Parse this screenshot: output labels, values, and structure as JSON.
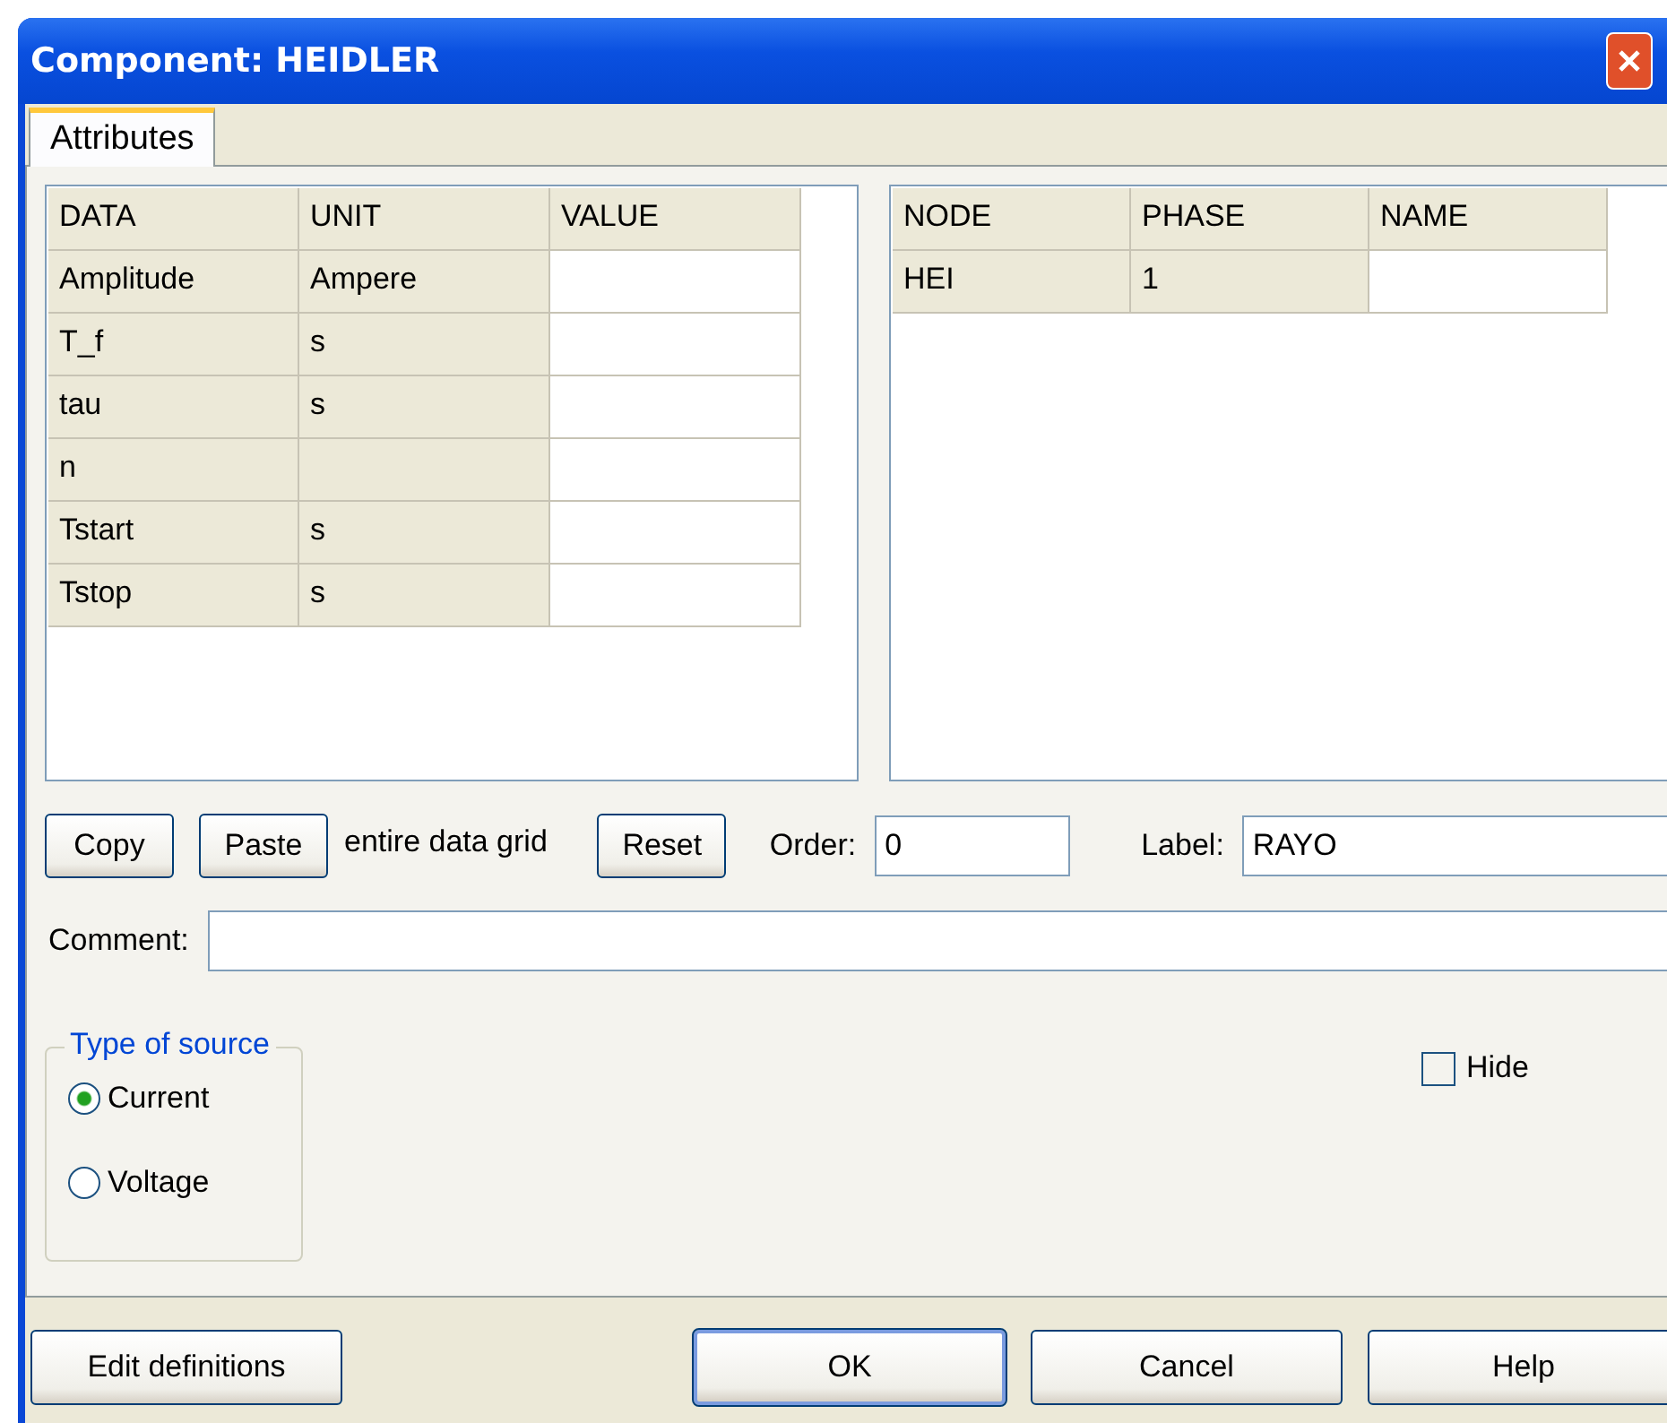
{
  "window": {
    "title": "Component: HEIDLER"
  },
  "tabs": [
    {
      "label": "Attributes",
      "selected": true
    }
  ],
  "data_grid": {
    "columns": [
      "DATA",
      "UNIT",
      "VALUE"
    ],
    "rows": [
      {
        "data": "Amplitude",
        "unit": "Ampere",
        "value": ""
      },
      {
        "data": "T_f",
        "unit": "s",
        "value": ""
      },
      {
        "data": "tau",
        "unit": "s",
        "value": ""
      },
      {
        "data": "n",
        "unit": "",
        "value": ""
      },
      {
        "data": "Tstart",
        "unit": "s",
        "value": ""
      },
      {
        "data": "Tstop",
        "unit": "s",
        "value": ""
      }
    ]
  },
  "node_grid": {
    "columns": [
      "NODE",
      "PHASE",
      "NAME"
    ],
    "rows": [
      {
        "node": "HEI",
        "phase": "1",
        "name": ""
      }
    ]
  },
  "grid_buttons": {
    "copy": "Copy",
    "paste": "Paste",
    "caption": "entire data grid",
    "reset": "Reset"
  },
  "order": {
    "label": "Order:",
    "value": "0"
  },
  "label_field": {
    "label": "Label:",
    "value": "RAYO"
  },
  "comment": {
    "label": "Comment:"
  },
  "source_type": {
    "title": "Type of source",
    "options": [
      {
        "label": "Current",
        "selected": true
      },
      {
        "label": "Voltage",
        "selected": false
      }
    ]
  },
  "hide": {
    "label": "Hide",
    "checked": false
  },
  "footer_buttons": [
    {
      "label": "Edit definitions",
      "kind": "left"
    },
    {
      "label": "OK",
      "kind": "default"
    },
    {
      "label": "Cancel",
      "kind": "normal"
    },
    {
      "label": "Help",
      "kind": "normal"
    }
  ]
}
